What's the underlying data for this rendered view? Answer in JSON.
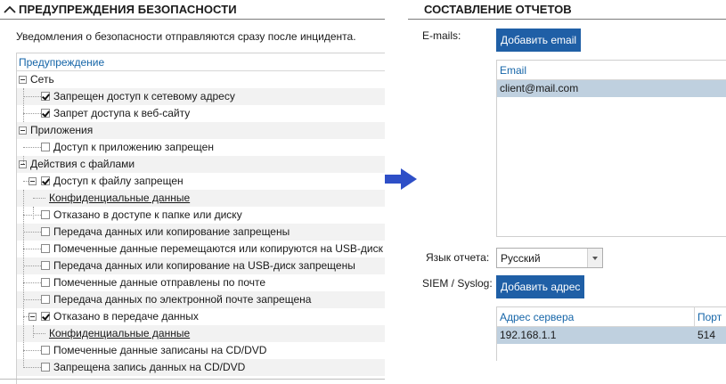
{
  "left": {
    "title": "ПРЕДУПРЕЖДЕНИЯ БЕЗОПАСНОСТИ",
    "description": "Уведомления о безопасности отправляются сразу после инцидента.",
    "column_header": "Предупреждение",
    "tree": [
      {
        "label": "Сеть",
        "kind": "group",
        "checked": null
      },
      {
        "label": "Запрещен доступ к сетевому адресу",
        "kind": "item",
        "checked": true
      },
      {
        "label": "Запрет доступа к веб-сайту",
        "kind": "item",
        "checked": true
      },
      {
        "label": "Приложения",
        "kind": "group",
        "checked": null
      },
      {
        "label": "Доступ к приложению запрещен",
        "kind": "item",
        "checked": false
      },
      {
        "label": "Действия с файлами",
        "kind": "group",
        "checked": null
      },
      {
        "label": "Доступ к файлу запрещен",
        "kind": "subgroup",
        "checked": true
      },
      {
        "label": "Конфиденциальные данные",
        "kind": "link",
        "checked": null
      },
      {
        "label": "Отказано в доступе к папке или диску",
        "kind": "item",
        "checked": false
      },
      {
        "label": "Передача данных или копирование запрещены",
        "kind": "item",
        "checked": false
      },
      {
        "label": "Помеченные данные перемещаются или копируются на USB-диск",
        "kind": "item",
        "checked": false
      },
      {
        "label": "Передача данных или копирование на USB-диск запрещены",
        "kind": "item",
        "checked": false
      },
      {
        "label": "Помеченные данные отправлены по почте",
        "kind": "item",
        "checked": false
      },
      {
        "label": "Передача данных по электронной почте запрещена",
        "kind": "item",
        "checked": false
      },
      {
        "label": "Отказано в передаче данных",
        "kind": "subgroup",
        "checked": true
      },
      {
        "label": "Конфиденциальные данные",
        "kind": "link",
        "checked": null
      },
      {
        "label": "Помеченные данные записаны на CD/DVD",
        "kind": "item",
        "checked": false
      },
      {
        "label": "Запрещена запись данных на CD/DVD",
        "kind": "item",
        "checked": false
      }
    ]
  },
  "right": {
    "title": "СОСТАВЛЕНИЕ ОТЧЕТОВ",
    "emails_label": "E-mails:",
    "add_email_button": "Добавить email",
    "email_column_header": "Email",
    "emails": [
      "client@mail.com"
    ],
    "report_language_label": "Язык отчета:",
    "report_language_value": "Русский",
    "siem_label": "SIEM / Syslog:",
    "add_address_button": "Добавить адрес",
    "server_columns": [
      "Адрес сервера",
      "Порт"
    ],
    "servers": [
      {
        "address": "192.168.1.1",
        "port": "514"
      }
    ]
  },
  "colors": {
    "accent_button": "#1f5fa6",
    "arrow": "#2e4fc7",
    "selection": "#bfd0df",
    "header_link": "#1565a8"
  }
}
